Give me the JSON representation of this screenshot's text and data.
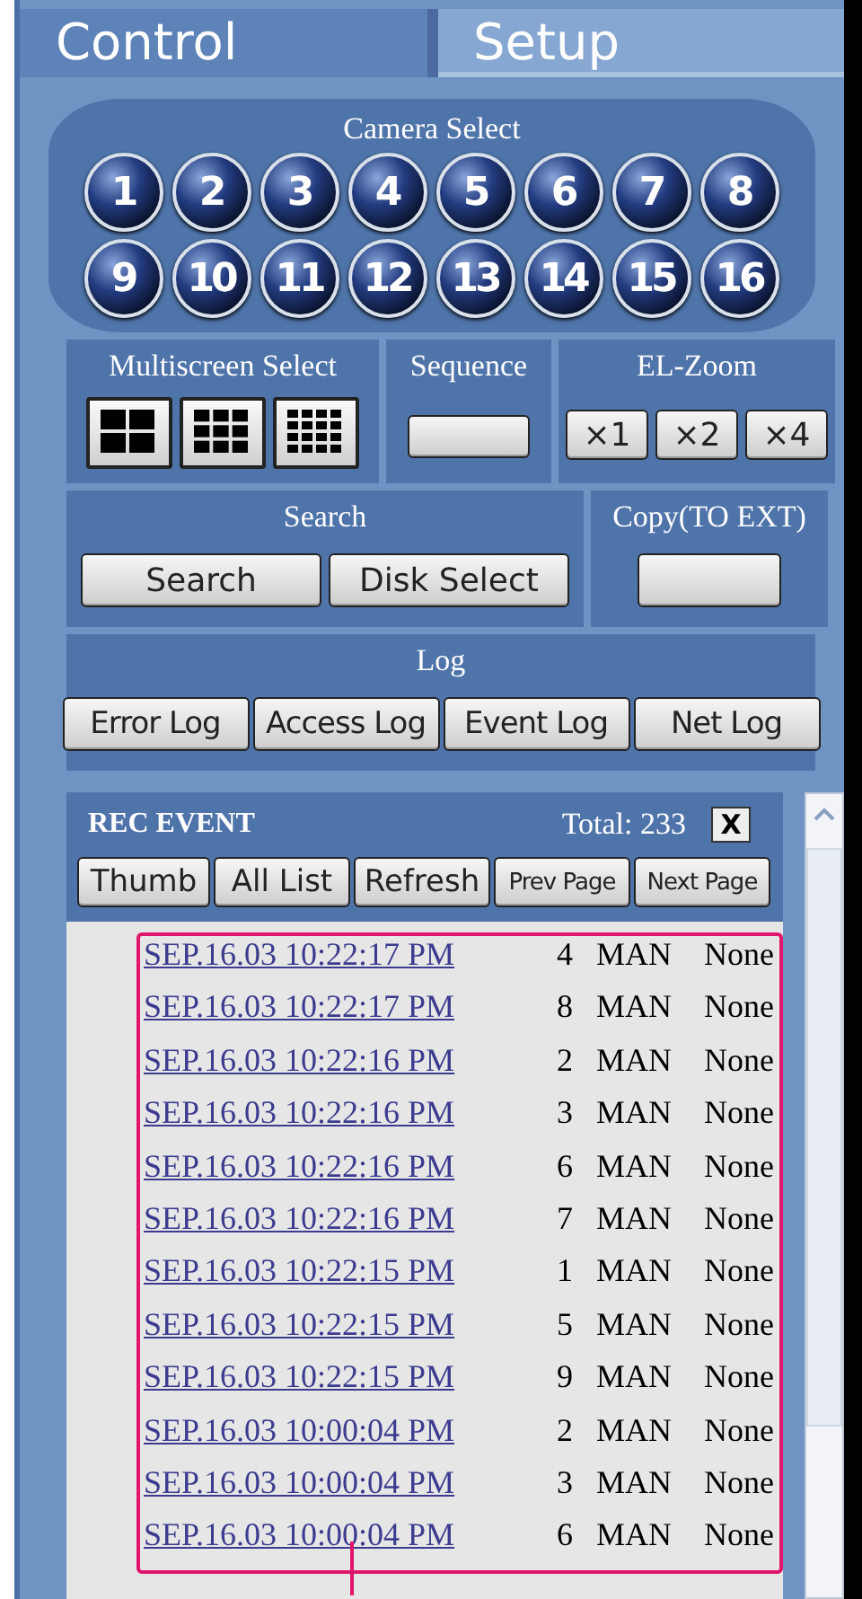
{
  "tabs": [
    {
      "label": "Control",
      "selected": true
    },
    {
      "label": "Setup",
      "selected": false
    }
  ],
  "camera_select": {
    "title": "Camera Select",
    "cameras": [
      "1",
      "2",
      "3",
      "4",
      "5",
      "6",
      "7",
      "8",
      "9",
      "10",
      "11",
      "12",
      "13",
      "14",
      "15",
      "16"
    ]
  },
  "multiscreen_select": {
    "title": "Multiscreen Select",
    "layouts": [
      {
        "kind": "split-4"
      },
      {
        "kind": "split-9"
      },
      {
        "kind": "split-16"
      }
    ]
  },
  "sequence": {
    "title": "Sequence"
  },
  "el_zoom": {
    "title": "EL-Zoom",
    "buttons": [
      "×1",
      "×2",
      "×4"
    ]
  },
  "search": {
    "title": "Search",
    "buttons": [
      "Search",
      "Disk Select"
    ]
  },
  "copy": {
    "title": "Copy(TO EXT)"
  },
  "log": {
    "title": "Log",
    "buttons": [
      "Error Log",
      "Access Log",
      "Event Log",
      "Net Log"
    ]
  },
  "rec_event": {
    "title": "REC EVENT",
    "total": "Total: 233",
    "close": "X",
    "buttons": [
      "Thumb",
      "All List",
      "Refresh",
      "Prev Page",
      "Next Page"
    ],
    "rows": [
      {
        "time": "SEP.16.03 10:22:17 PM",
        "camera": "4",
        "mode": "MAN",
        "status": "None"
      },
      {
        "time": "SEP.16.03 10:22:17 PM",
        "camera": "8",
        "mode": "MAN",
        "status": "None"
      },
      {
        "time": "SEP.16.03 10:22:16 PM",
        "camera": "2",
        "mode": "MAN",
        "status": "None"
      },
      {
        "time": "SEP.16.03 10:22:16 PM",
        "camera": "3",
        "mode": "MAN",
        "status": "None"
      },
      {
        "time": "SEP.16.03 10:22:16 PM",
        "camera": "6",
        "mode": "MAN",
        "status": "None"
      },
      {
        "time": "SEP.16.03 10:22:16 PM",
        "camera": "7",
        "mode": "MAN",
        "status": "None"
      },
      {
        "time": "SEP.16.03 10:22:15 PM",
        "camera": "1",
        "mode": "MAN",
        "status": "None"
      },
      {
        "time": "SEP.16.03 10:22:15 PM",
        "camera": "5",
        "mode": "MAN",
        "status": "None"
      },
      {
        "time": "SEP.16.03 10:22:15 PM",
        "camera": "9",
        "mode": "MAN",
        "status": "None"
      },
      {
        "time": "SEP.16.03 10:00:04 PM",
        "camera": "2",
        "mode": "MAN",
        "status": "None"
      },
      {
        "time": "SEP.16.03 10:00:04 PM",
        "camera": "3",
        "mode": "MAN",
        "status": "None"
      },
      {
        "time": "SEP.16.03 10:00:04 PM",
        "camera": "6",
        "mode": "MAN",
        "status": "None"
      }
    ]
  }
}
